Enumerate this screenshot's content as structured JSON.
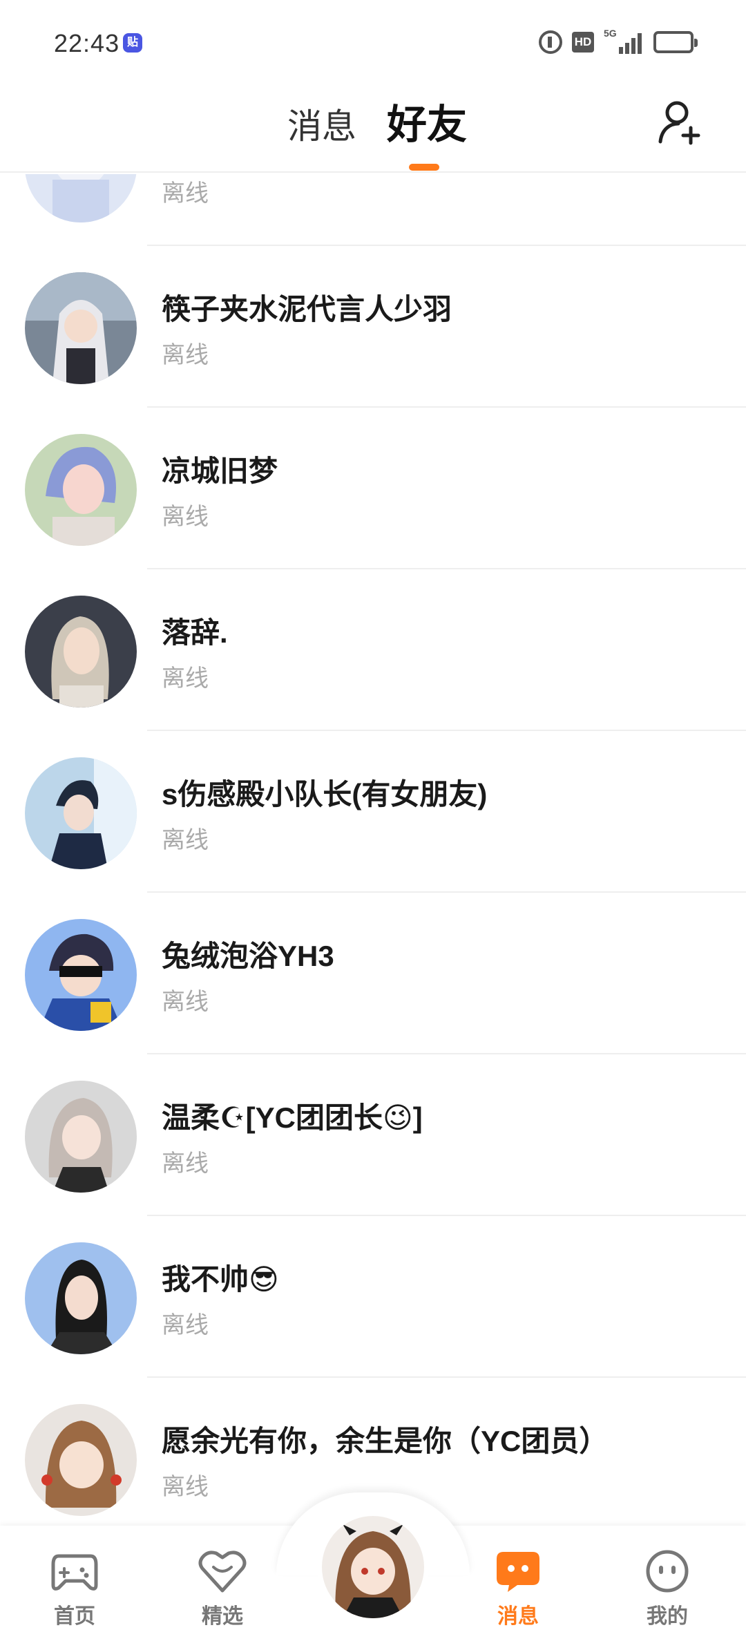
{
  "status_bar": {
    "time": "22:43",
    "app_badge": "贴",
    "network": "5G"
  },
  "header": {
    "tabs": [
      {
        "label": "消息",
        "active": false
      },
      {
        "label": "好友",
        "active": true
      }
    ],
    "accent_color": "#ff7a1a"
  },
  "friends": [
    {
      "name": "",
      "status": "离线"
    },
    {
      "name": "筷子夹水泥代言人少羽",
      "status": "离线"
    },
    {
      "name": "凉城旧梦",
      "status": "离线"
    },
    {
      "name": "落辞.",
      "status": "离线"
    },
    {
      "name": "s伤感殿小队长(有女朋友)",
      "status": "离线"
    },
    {
      "name": "兔绒泡浴YH3",
      "status": "离线"
    },
    {
      "name": "温柔☪[YC团团长😉]",
      "status": "离线"
    },
    {
      "name": "我不帅😎",
      "status": "离线"
    },
    {
      "name": "愿余光有你，余生是你（YC团员）",
      "status": "离线"
    }
  ],
  "bottom_nav": {
    "items": [
      {
        "label": "首页",
        "icon": "gamepad-icon",
        "active": false
      },
      {
        "label": "精选",
        "icon": "heart-shield-icon",
        "active": false
      },
      {
        "label": "消息",
        "icon": "chat-bubble-icon",
        "active": true
      },
      {
        "label": "我的",
        "icon": "face-icon",
        "active": false
      }
    ]
  }
}
